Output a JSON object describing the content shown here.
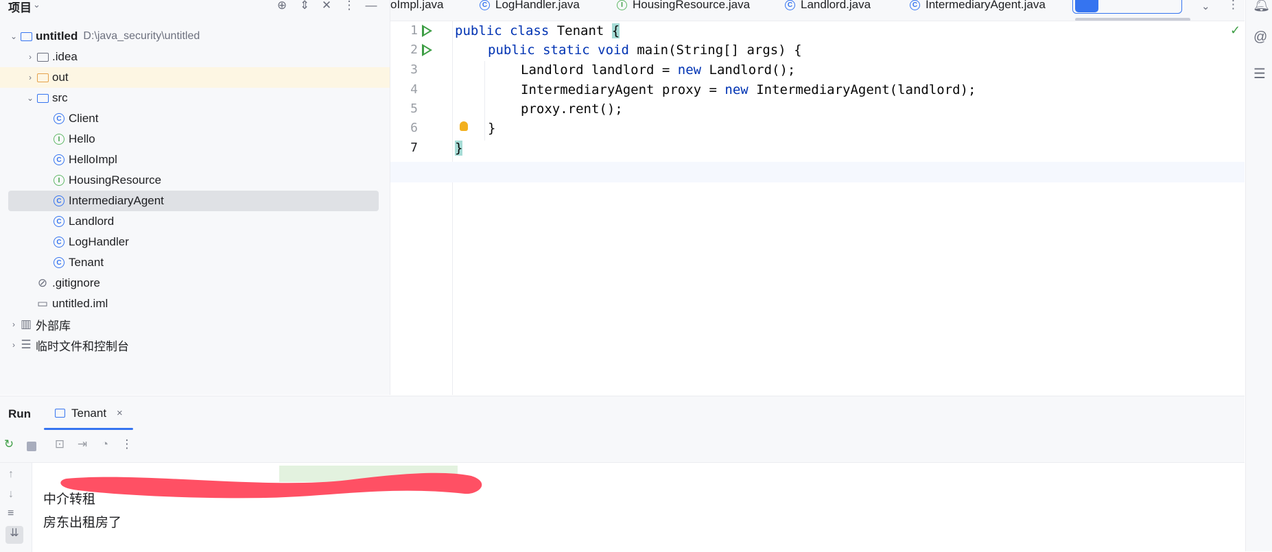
{
  "project": {
    "title": "项目",
    "tree": [
      {
        "label": "untitled",
        "path": "D:\\java_security\\untitled",
        "type": "module",
        "expanded": true,
        "depth": 0
      },
      {
        "label": ".idea",
        "type": "folder",
        "depth": 1
      },
      {
        "label": "out",
        "type": "folder-orange",
        "depth": 1
      },
      {
        "label": "src",
        "type": "folder-blue",
        "expanded": true,
        "depth": 1
      },
      {
        "label": "Client",
        "type": "class-run",
        "depth": 2
      },
      {
        "label": "Hello",
        "type": "interface",
        "depth": 2
      },
      {
        "label": "HelloImpl",
        "type": "class",
        "depth": 2
      },
      {
        "label": "HousingResource",
        "type": "interface",
        "depth": 2
      },
      {
        "label": "IntermediaryAgent",
        "type": "class",
        "depth": 2,
        "selected": true
      },
      {
        "label": "Landlord",
        "type": "class",
        "depth": 2
      },
      {
        "label": "LogHandler",
        "type": "class",
        "depth": 2
      },
      {
        "label": "Tenant",
        "type": "class-run",
        "depth": 2
      },
      {
        "label": ".gitignore",
        "type": "ignore",
        "depth": 1
      },
      {
        "label": "untitled.iml",
        "type": "iml",
        "depth": 1
      },
      {
        "label": "外部库",
        "type": "library",
        "depth": 0
      },
      {
        "label": "临时文件和控制台",
        "type": "scratch",
        "depth": 0
      }
    ]
  },
  "editor": {
    "tabs": [
      {
        "label": "oImpl.java",
        "icon": "class-icon"
      },
      {
        "label": "LogHandler.java",
        "icon": "class-icon"
      },
      {
        "label": "HousingResource.java",
        "icon": "interface-icon"
      },
      {
        "label": "Landlord.java",
        "icon": "class-icon"
      },
      {
        "label": "IntermediaryAgent.java",
        "icon": "class-icon"
      }
    ],
    "line_numbers": [
      "1",
      "2",
      "3",
      "4",
      "5",
      "6",
      "7"
    ],
    "code": {
      "l1a": "public class ",
      "l1b": "Tenant ",
      "l1c": "{",
      "l2a": "public static void ",
      "l2b": "main(String[] args) {",
      "l3a": "Landlord landlord = ",
      "l3b": "new ",
      "l3c": "Landlord();",
      "l4a": "IntermediaryAgent proxy = ",
      "l4b": "new ",
      "l4c": "IntermediaryAgent(landlord);",
      "l5": "proxy.rent();",
      "l6": "}",
      "l7": "}"
    }
  },
  "run": {
    "title": "Run",
    "tab_label": "Tenant",
    "output": [
      "中介转租",
      "房东出租房了"
    ]
  },
  "colors": {
    "accent": "#3574f0",
    "run_green": "#3e9e45",
    "redaction": "#ff5064"
  }
}
